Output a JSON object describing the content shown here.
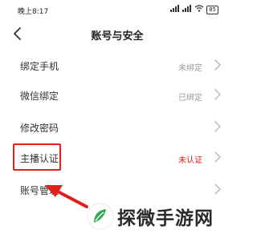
{
  "status_bar": {
    "time": "晚上8:17",
    "signal_icon": "signal-icon",
    "wifi_icon": "wifi-icon",
    "battery_text": "85"
  },
  "header": {
    "title": "账号与安全",
    "back_icon": "chevron-left-icon"
  },
  "rows": [
    {
      "label": "绑定手机",
      "value": "未绑定"
    },
    {
      "label": "微信绑定",
      "value": "已绑定"
    },
    {
      "label": "修改密码",
      "value": ""
    },
    {
      "label": "主播认证",
      "value": "未认证"
    },
    {
      "label": "账号管理",
      "value": ""
    }
  ],
  "annotation": {
    "highlight_color": "#e0201b"
  },
  "watermark": {
    "text": "探微手游网",
    "logo_color": "#2fa84f"
  }
}
